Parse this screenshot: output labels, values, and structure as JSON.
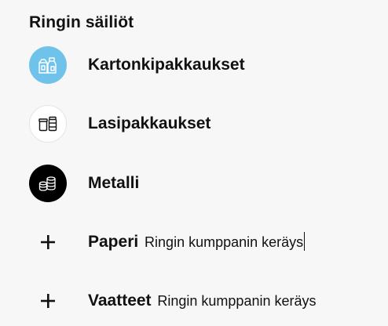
{
  "section": {
    "title": "Ringin säiliöt"
  },
  "items": [
    {
      "label": "Kartonkipakkaukset",
      "icon": "carton-icon",
      "color": "#6fc3eb"
    },
    {
      "label": "Lasipakkaukset",
      "icon": "glass-jars-icon",
      "color": "#ffffff"
    },
    {
      "label": "Metalli",
      "icon": "metal-cans-icon",
      "color": "#000000"
    },
    {
      "label": "Paperi",
      "sublabel": "Ringin kumppanin keräys",
      "icon": "plus-icon"
    },
    {
      "label": "Vaatteet",
      "sublabel": "Ringin kumppanin keräys",
      "icon": "plus-icon"
    }
  ]
}
